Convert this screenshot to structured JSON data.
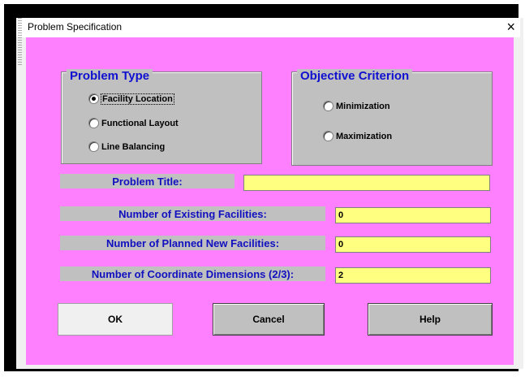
{
  "window": {
    "title": "Problem Specification",
    "close_glyph": "×"
  },
  "problem_type": {
    "title": "Problem Type",
    "options": [
      "Facility Location",
      "Functional Layout",
      "Line Balancing"
    ],
    "selected": "Facility Location"
  },
  "objective": {
    "title": "Objective Criterion",
    "options": [
      "Minimization",
      "Maximization"
    ]
  },
  "fields": {
    "problem_title": {
      "label": "Problem Title:",
      "value": ""
    },
    "existing": {
      "label": "Number of Existing Facilities:",
      "value": "0"
    },
    "planned": {
      "label": "Number of Planned New Facilities:",
      "value": "0"
    },
    "dimensions": {
      "label": "Number of Coordinate Dimensions (2/3):",
      "value": "2"
    }
  },
  "buttons": {
    "ok": "OK",
    "cancel": "Cancel",
    "help": "Help"
  },
  "colors": {
    "client_bg": "#ff80ff",
    "group_bg": "#c0c0c0",
    "label_text": "#1010c0",
    "field_bg": "#ffff80"
  }
}
